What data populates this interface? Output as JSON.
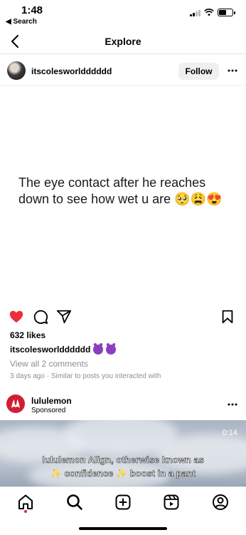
{
  "status_bar": {
    "time": "1:48",
    "back_app": "◀ Search"
  },
  "header": {
    "title": "Explore"
  },
  "post": {
    "username": "itscolesworldddddd",
    "follow_label": "Follow",
    "image_text": "The eye contact after he reaches down to see how wet u are 🥺😩😍",
    "likes": "632 likes",
    "caption_username": "itscolesworldddddd",
    "view_comments": "View all 2 comments",
    "meta": "3 days ago · Similar to posts you interacted with",
    "liked": true,
    "like_color": "#ed2f3a"
  },
  "ad": {
    "name": "lululemon",
    "sponsored": "Sponsored",
    "brand_color": "#d31d35",
    "video_time": "0:14",
    "subtitle_line1": "lululemon Align, otherwise known as",
    "subtitle_line2": "✨ confidence ✨ boost in a pant"
  },
  "tab_bar": {
    "tabs": [
      "home-icon",
      "search-icon",
      "create-icon",
      "reels-icon",
      "profile-icon"
    ],
    "active": "home-icon"
  }
}
